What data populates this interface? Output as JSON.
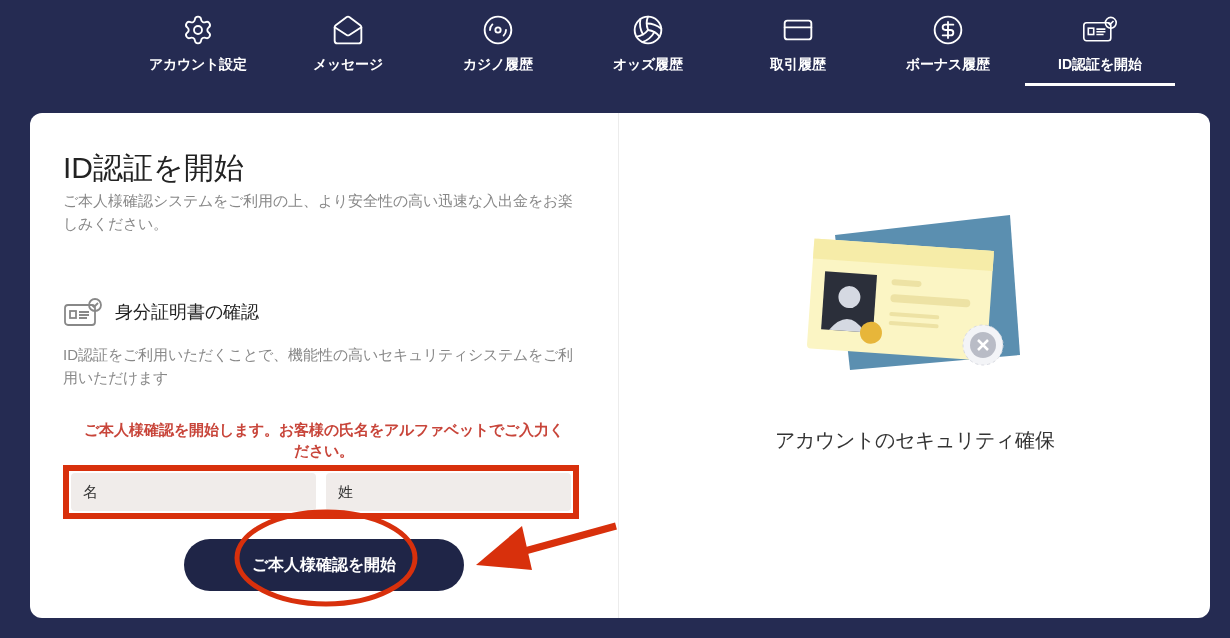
{
  "nav": [
    {
      "label": "アカウント設定",
      "kind": "settings",
      "selected": false
    },
    {
      "label": "メッセージ",
      "kind": "messages",
      "selected": false
    },
    {
      "label": "カジノ履歴",
      "kind": "casino",
      "selected": false
    },
    {
      "label": "オッズ履歴",
      "kind": "odds",
      "selected": false
    },
    {
      "label": "取引履歴",
      "kind": "transactions",
      "selected": false
    },
    {
      "label": "ボーナス履歴",
      "kind": "bonus",
      "selected": false
    },
    {
      "label": "ID認証を開始",
      "kind": "verification",
      "selected": true
    }
  ],
  "panel": {
    "title": "ID認証を開始",
    "intro": "ご本人様確認システムをご利用の上、より安全性の高い迅速な入出金をお楽しみください。",
    "section": {
      "heading": "身分証明書の確認",
      "text": "ID認証をご利用いただくことで、機能性の高いセキュリティシステムをご利用いただけます"
    },
    "notice": "ご本人様確認を開始します。お客様の氏名をアルファベットでご入力ください。",
    "fields": [
      {
        "placeholder": "名"
      },
      {
        "placeholder": "姓"
      }
    ],
    "button": "ご本人様確認を開始"
  },
  "aside": {
    "caption": "アカウントのセキュリティ確保"
  }
}
